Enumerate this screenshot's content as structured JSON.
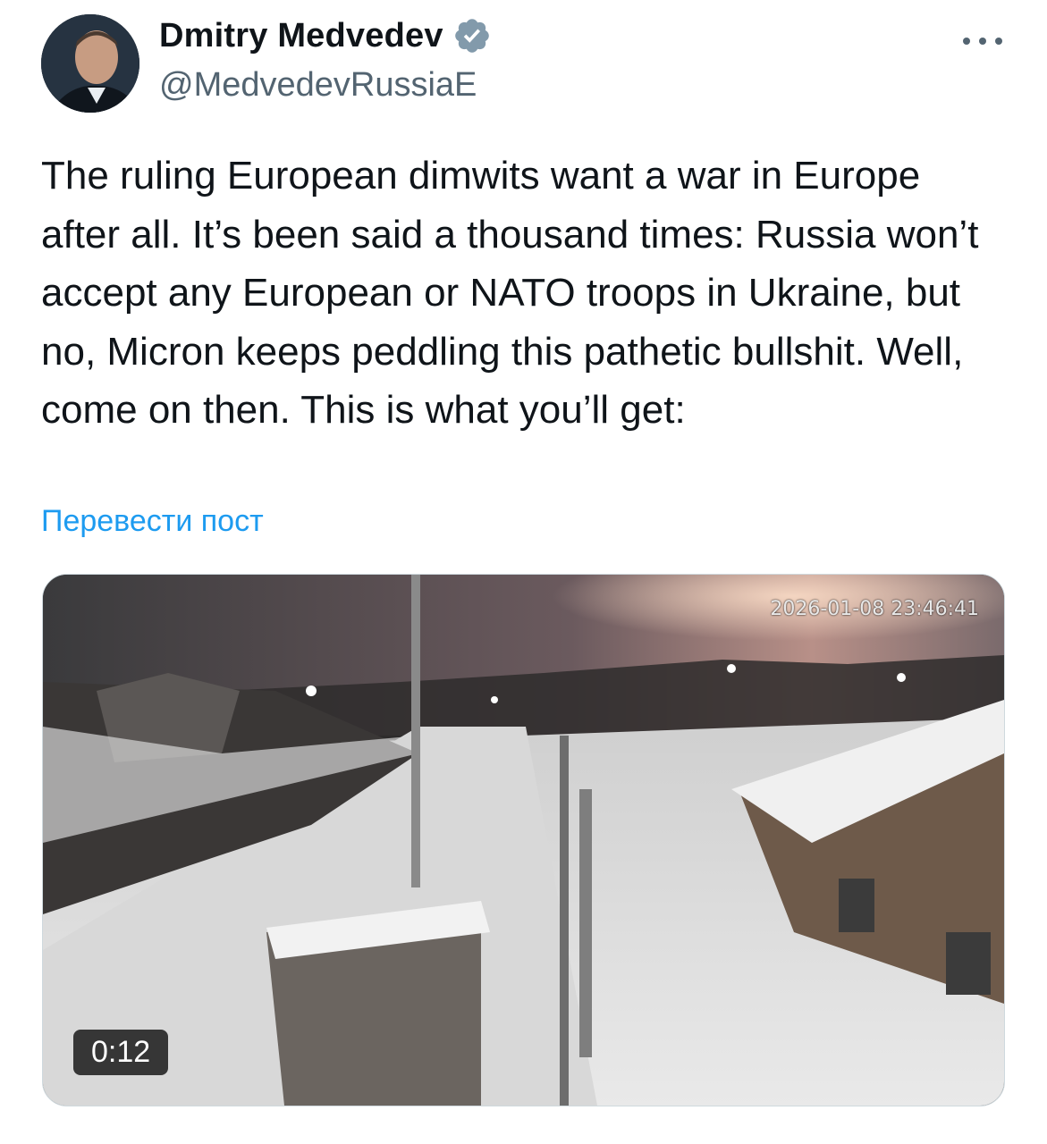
{
  "author": {
    "display_name": "Dmitry Medvedev",
    "handle": "@MedvedevRussiaE",
    "verified_icon": "verified-badge-icon",
    "avatar_icon": "avatar"
  },
  "tweet": {
    "text": "The ruling European dimwits want a war in Europe after all. It’s been said a thousand times: Russia won’t accept any European or NATO troops in Ukraine, but no, Micron keeps peddling this pathetic bullshit. Well, come on then. This is what you’ll get:",
    "translate_label": "Перевести пост"
  },
  "media": {
    "camera_timestamp": "2026-01-08 23:46:41",
    "duration": "0:12"
  },
  "colors": {
    "link": "#1d9bf0",
    "secondary_text": "#536471",
    "verified_badge": "#829aab"
  }
}
